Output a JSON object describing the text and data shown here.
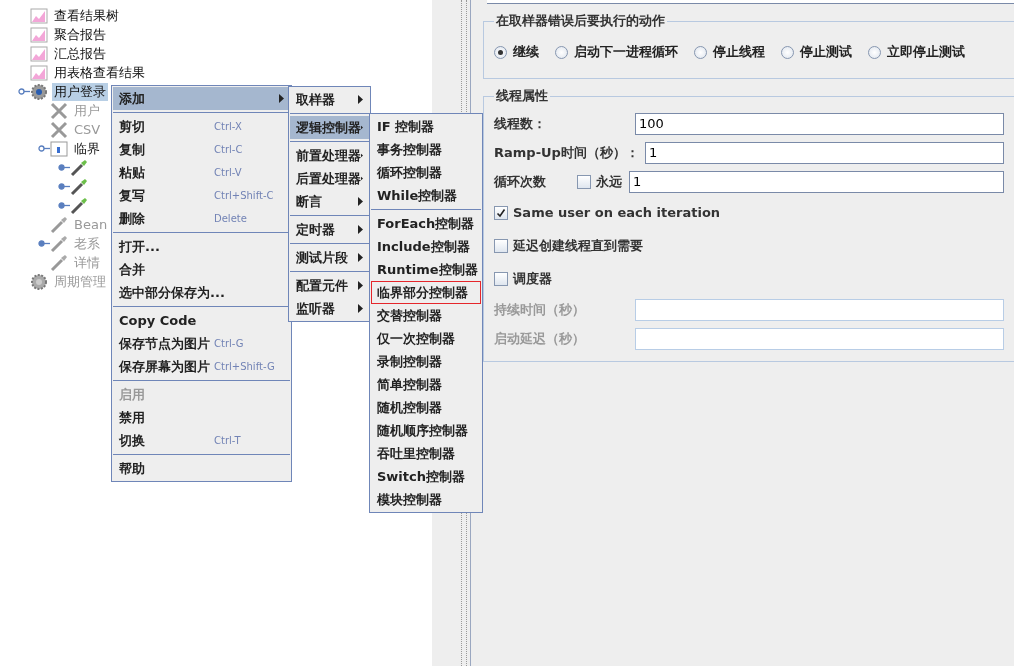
{
  "tree": [
    {
      "label": "查看结果树",
      "kind": "listener",
      "disabled": false,
      "selected": false
    },
    {
      "label": "聚合报告",
      "kind": "listener",
      "disabled": false,
      "selected": false
    },
    {
      "label": "汇总报告",
      "kind": "listener",
      "disabled": false,
      "selected": false
    },
    {
      "label": "用表格查看结果",
      "kind": "listener",
      "disabled": false,
      "selected": false
    },
    {
      "label": "用户登录",
      "kind": "thread_group",
      "disabled": false,
      "selected": true,
      "expanded": true,
      "children": [
        {
          "label": "用户",
          "kind": "config",
          "disabled": true,
          "selected": false
        },
        {
          "label": "CSV",
          "kind": "config",
          "disabled": true,
          "selected": false
        },
        {
          "label": "临界",
          "kind": "controller",
          "disabled": false,
          "selected": false,
          "expanded": true,
          "children": [
            {
              "kind": "sampler",
              "disabled": false,
              "expanded": false
            },
            {
              "kind": "sampler",
              "disabled": false,
              "expanded": false
            },
            {
              "kind": "sampler",
              "disabled": false,
              "expanded": false
            }
          ]
        },
        {
          "label": "Bean",
          "kind": "sampler",
          "disabled": true,
          "selected": false
        },
        {
          "label": "老系",
          "kind": "sampler",
          "disabled": true,
          "selected": false,
          "expanded": false
        },
        {
          "label": "详情",
          "kind": "sampler",
          "disabled": true,
          "selected": false
        }
      ]
    },
    {
      "label": "周期管理",
      "kind": "thread_group",
      "disabled": true,
      "selected": false
    }
  ],
  "context_menu": {
    "groups": [
      [
        {
          "label": "添加",
          "submenu": true,
          "selected": true,
          "disabled": false
        }
      ],
      [
        {
          "label": "剪切",
          "shortcut": "Ctrl-X",
          "submenu": false,
          "selected": false,
          "disabled": false
        },
        {
          "label": "复制",
          "shortcut": "Ctrl-C",
          "submenu": false,
          "selected": false,
          "disabled": false
        },
        {
          "label": "粘贴",
          "shortcut": "Ctrl-V",
          "submenu": false,
          "selected": false,
          "disabled": false
        },
        {
          "label": "复写",
          "shortcut": "Ctrl+Shift-C",
          "submenu": false,
          "selected": false,
          "disabled": false
        },
        {
          "label": "删除",
          "shortcut": "Delete",
          "submenu": false,
          "selected": false,
          "disabled": false
        }
      ],
      [
        {
          "label": "打开...",
          "submenu": false,
          "selected": false,
          "disabled": false
        },
        {
          "label": "合并",
          "submenu": false,
          "selected": false,
          "disabled": false
        },
        {
          "label": "选中部分保存为...",
          "submenu": false,
          "selected": false,
          "disabled": false
        }
      ],
      [
        {
          "label": "Copy Code",
          "submenu": false,
          "selected": false,
          "disabled": false
        },
        {
          "label": "保存节点为图片",
          "shortcut": "Ctrl-G",
          "submenu": false,
          "selected": false,
          "disabled": false
        },
        {
          "label": "保存屏幕为图片",
          "shortcut": "Ctrl+Shift-G",
          "submenu": false,
          "selected": false,
          "disabled": false
        }
      ],
      [
        {
          "label": "启用",
          "submenu": false,
          "selected": false,
          "disabled": true
        },
        {
          "label": "禁用",
          "submenu": false,
          "selected": false,
          "disabled": false
        },
        {
          "label": "切换",
          "shortcut": "Ctrl-T",
          "submenu": false,
          "selected": false,
          "disabled": false
        }
      ],
      [
        {
          "label": "帮助",
          "submenu": false,
          "selected": false,
          "disabled": false
        }
      ]
    ]
  },
  "add_submenu": {
    "groups": [
      [
        {
          "label": "取样器",
          "submenu": true,
          "selected": false
        }
      ],
      [
        {
          "label": "逻辑控制器",
          "submenu": true,
          "selected": true
        }
      ],
      [
        {
          "label": "前置处理器",
          "submenu": true,
          "selected": false
        },
        {
          "label": "后置处理器",
          "submenu": true,
          "selected": false
        },
        {
          "label": "断言",
          "submenu": true,
          "selected": false
        }
      ],
      [
        {
          "label": "定时器",
          "submenu": true,
          "selected": false
        }
      ],
      [
        {
          "label": "测试片段",
          "submenu": true,
          "selected": false
        }
      ],
      [
        {
          "label": "配置元件",
          "submenu": true,
          "selected": false
        },
        {
          "label": "监听器",
          "submenu": true,
          "selected": false
        }
      ]
    ]
  },
  "controller_submenu": {
    "groups": [
      [
        {
          "label": "IF 控制器",
          "selected": false,
          "outlined": false
        },
        {
          "label": "事务控制器",
          "selected": false,
          "outlined": false
        },
        {
          "label": "循环控制器",
          "selected": false,
          "outlined": false
        },
        {
          "label": "While控制器",
          "selected": false,
          "outlined": false
        }
      ],
      [
        {
          "label": "ForEach控制器",
          "selected": false,
          "outlined": false
        },
        {
          "label": "Include控制器",
          "selected": false,
          "outlined": false
        },
        {
          "label": "Runtime控制器",
          "selected": false,
          "outlined": false
        },
        {
          "label": "临界部分控制器",
          "selected": false,
          "outlined": true
        },
        {
          "label": "交替控制器",
          "selected": false,
          "outlined": false
        },
        {
          "label": "仅一次控制器",
          "selected": false,
          "outlined": false
        },
        {
          "label": "录制控制器",
          "selected": false,
          "outlined": false
        },
        {
          "label": "简单控制器",
          "selected": false,
          "outlined": false
        },
        {
          "label": "随机控制器",
          "selected": false,
          "outlined": false
        },
        {
          "label": "随机顺序控制器",
          "selected": false,
          "outlined": false
        },
        {
          "label": "吞吐里控制器",
          "selected": false,
          "outlined": false
        },
        {
          "label": "Switch控制器",
          "selected": false,
          "outlined": false
        },
        {
          "label": "模块控制器",
          "selected": false,
          "outlined": false
        }
      ]
    ]
  },
  "error_action": {
    "title": "在取样器错误后要执行的动作",
    "options": [
      {
        "label": "继续",
        "selected": true
      },
      {
        "label": "启动下一进程循环",
        "selected": false
      },
      {
        "label": "停止线程",
        "selected": false
      },
      {
        "label": "停止测试",
        "selected": false
      },
      {
        "label": "立即停止测试",
        "selected": false
      }
    ]
  },
  "thread_properties": {
    "title": "线程属性",
    "threads": {
      "label": "线程数：",
      "value": "100"
    },
    "ramp_up": {
      "label": "Ramp-Up时间（秒）：",
      "value": "1"
    },
    "loop_count": {
      "label": "循环次数",
      "forever": {
        "label": "永远",
        "checked": false
      },
      "value": "1"
    },
    "checkboxes": [
      {
        "label": "Same user on each iteration",
        "checked": true
      },
      {
        "label": "延迟创建线程直到需要",
        "checked": false
      },
      {
        "label": "调度器",
        "checked": false
      }
    ],
    "duration": {
      "label": "持续时间（秒）",
      "disabled": true
    },
    "startup_delay": {
      "label": "启动延迟（秒）",
      "disabled": true
    }
  }
}
